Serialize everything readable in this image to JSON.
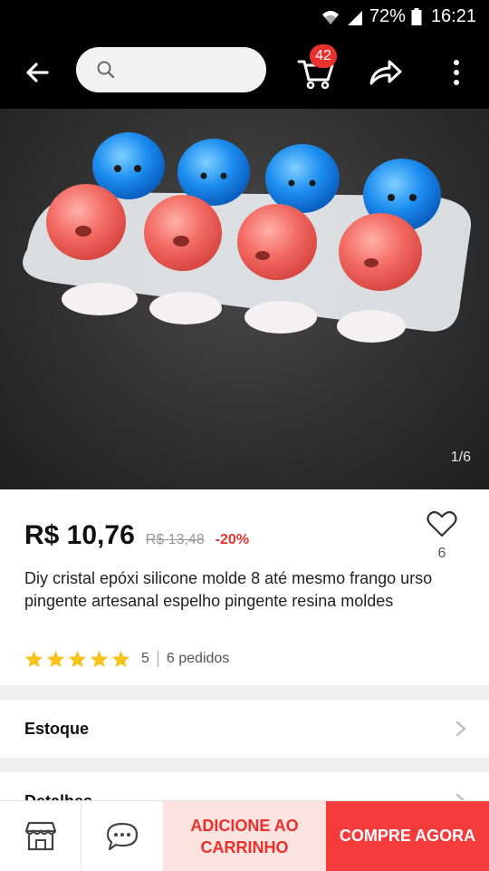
{
  "status_bar": {
    "battery": "72%",
    "time": "16:21"
  },
  "header": {
    "search_placeholder": "",
    "cart_count": "42",
    "colors": {
      "background": "#000000",
      "badge": "#e9322e"
    },
    "icons": [
      "back-arrow-icon",
      "search-icon",
      "cart-icon",
      "share-icon",
      "more-vertical-icon"
    ]
  },
  "gallery": {
    "counter": "1/6"
  },
  "product": {
    "price": "R$ 10,76",
    "old_price": "R$ 13,48",
    "discount": "-20%",
    "wishlist_count": "6",
    "title": "Diy cristal epóxi silicone molde 8 até mesmo frango urso pingente artesanal espelho pingente resina moldes",
    "rating": "5",
    "orders": "6 pedidos",
    "star_rating": 5
  },
  "sections": {
    "stock": "Estoque",
    "details": "Detalhes"
  },
  "bottom_bar": {
    "add_to_cart": "ADICIONE AO CARRINHO",
    "buy_now": "COMPRE AGORA",
    "colors": {
      "add_bg": "#fde3df",
      "buy_bg": "#f43c3c"
    }
  }
}
